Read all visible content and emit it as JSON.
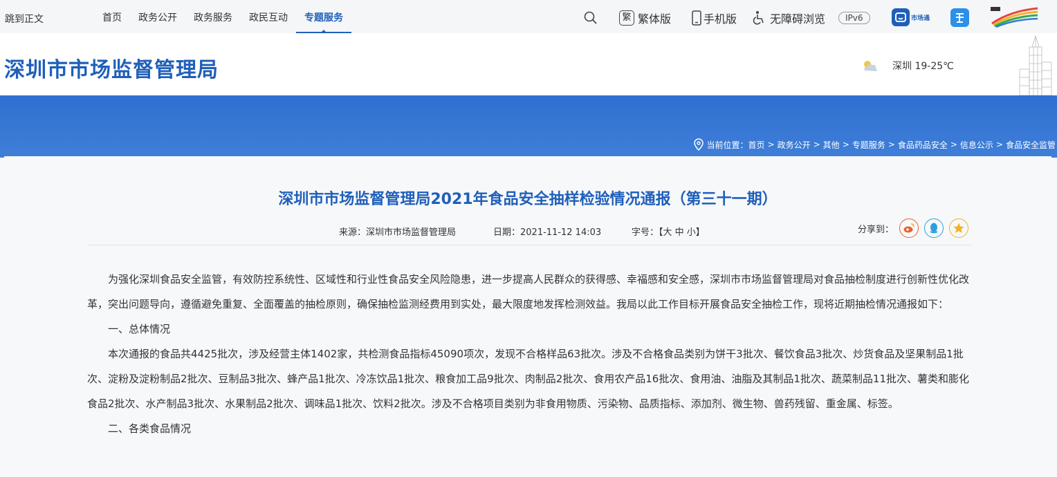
{
  "topnav": {
    "skip_label": "跳到正文",
    "links": [
      "首页",
      "政务公开",
      "政务服务",
      "政民互动",
      "专题服务"
    ],
    "active_link": "专题服务",
    "traditional_label": "繁体版",
    "traditional_badge": "繁",
    "mobile_label": "手机版",
    "accessibility_label": "无障碍浏览",
    "ipv6_label": "IPv6",
    "app_label": "市场通"
  },
  "header": {
    "site_title": "深圳市市场监督管理局",
    "weather": "深圳 19-25℃"
  },
  "breadcrumb": {
    "prefix": "当前位置：",
    "items": [
      "首页",
      "政务公开",
      "其他",
      "专题服务",
      "食品药品安全",
      "信息公示",
      "食品安全监管"
    ]
  },
  "article": {
    "title": "深圳市市场监督管理局2021年食品安全抽样检验情况通报（第三十一期）",
    "source": "来源：深圳市市场监督管理局",
    "date": "日期：2021-11-12 14:03",
    "font_size_label": "字号：【大  中  小】",
    "share_label": "分享到：",
    "paragraphs": [
      "为强化深圳食品安全监管，有效防控系统性、区域性和行业性食品安全风险隐患，进一步提高人民群众的获得感、幸福感和安全感，深圳市市场监督管理局对食品抽检制度进行创新性优化改革，突出问题导向，遵循避免重复、全面覆盖的抽检原则，确保抽检监测经费用到实处，最大限度地发挥检测效益。我局以此工作目标开展食品安全抽检工作，现将近期抽检情况通报如下：",
      "一、总体情况",
      "本次通报的食品共4425批次，涉及经营主体1402家，共检测食品指标45090项次，发现不合格样品63批次。涉及不合格食品类别为饼干3批次、餐饮食品3批次、炒货食品及坚果制品1批次、淀粉及淀粉制品2批次、豆制品3批次、蜂产品1批次、冷冻饮品1批次、粮食加工品9批次、肉制品2批次、食用农产品16批次、食用油、油脂及其制品1批次、蔬菜制品11批次、薯类和膨化食品2批次、水产制品3批次、水果制品2批次、调味品1批次、饮料2批次。涉及不合格项目类别为非食用物质、污染物、品质指标、添加剂、微生物、兽药残留、重金属、标签。",
      "二、各类食品情况"
    ]
  },
  "colors": {
    "accent": "#1f5fba",
    "banner": "#3a78d4",
    "weibo": "#e6632f",
    "qq": "#2c9fe0",
    "qzone": "#f0b323"
  }
}
